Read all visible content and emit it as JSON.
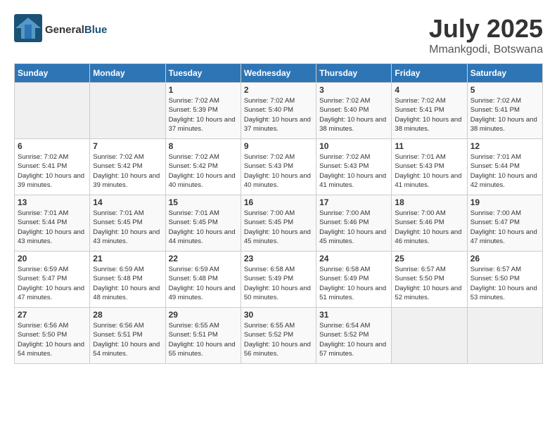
{
  "header": {
    "logo_general": "General",
    "logo_blue": "Blue",
    "month": "July 2025",
    "location": "Mmankgodi, Botswana"
  },
  "weekdays": [
    "Sunday",
    "Monday",
    "Tuesday",
    "Wednesday",
    "Thursday",
    "Friday",
    "Saturday"
  ],
  "weeks": [
    [
      {
        "day": "",
        "empty": true
      },
      {
        "day": "",
        "empty": true
      },
      {
        "day": "1",
        "sunrise": "7:02 AM",
        "sunset": "5:39 PM",
        "daylight": "10 hours and 37 minutes."
      },
      {
        "day": "2",
        "sunrise": "7:02 AM",
        "sunset": "5:40 PM",
        "daylight": "10 hours and 37 minutes."
      },
      {
        "day": "3",
        "sunrise": "7:02 AM",
        "sunset": "5:40 PM",
        "daylight": "10 hours and 38 minutes."
      },
      {
        "day": "4",
        "sunrise": "7:02 AM",
        "sunset": "5:41 PM",
        "daylight": "10 hours and 38 minutes."
      },
      {
        "day": "5",
        "sunrise": "7:02 AM",
        "sunset": "5:41 PM",
        "daylight": "10 hours and 38 minutes."
      }
    ],
    [
      {
        "day": "6",
        "sunrise": "7:02 AM",
        "sunset": "5:41 PM",
        "daylight": "10 hours and 39 minutes."
      },
      {
        "day": "7",
        "sunrise": "7:02 AM",
        "sunset": "5:42 PM",
        "daylight": "10 hours and 39 minutes."
      },
      {
        "day": "8",
        "sunrise": "7:02 AM",
        "sunset": "5:42 PM",
        "daylight": "10 hours and 40 minutes."
      },
      {
        "day": "9",
        "sunrise": "7:02 AM",
        "sunset": "5:43 PM",
        "daylight": "10 hours and 40 minutes."
      },
      {
        "day": "10",
        "sunrise": "7:02 AM",
        "sunset": "5:43 PM",
        "daylight": "10 hours and 41 minutes."
      },
      {
        "day": "11",
        "sunrise": "7:01 AM",
        "sunset": "5:43 PM",
        "daylight": "10 hours and 41 minutes."
      },
      {
        "day": "12",
        "sunrise": "7:01 AM",
        "sunset": "5:44 PM",
        "daylight": "10 hours and 42 minutes."
      }
    ],
    [
      {
        "day": "13",
        "sunrise": "7:01 AM",
        "sunset": "5:44 PM",
        "daylight": "10 hours and 43 minutes."
      },
      {
        "day": "14",
        "sunrise": "7:01 AM",
        "sunset": "5:45 PM",
        "daylight": "10 hours and 43 minutes."
      },
      {
        "day": "15",
        "sunrise": "7:01 AM",
        "sunset": "5:45 PM",
        "daylight": "10 hours and 44 minutes."
      },
      {
        "day": "16",
        "sunrise": "7:00 AM",
        "sunset": "5:45 PM",
        "daylight": "10 hours and 45 minutes."
      },
      {
        "day": "17",
        "sunrise": "7:00 AM",
        "sunset": "5:46 PM",
        "daylight": "10 hours and 45 minutes."
      },
      {
        "day": "18",
        "sunrise": "7:00 AM",
        "sunset": "5:46 PM",
        "daylight": "10 hours and 46 minutes."
      },
      {
        "day": "19",
        "sunrise": "7:00 AM",
        "sunset": "5:47 PM",
        "daylight": "10 hours and 47 minutes."
      }
    ],
    [
      {
        "day": "20",
        "sunrise": "6:59 AM",
        "sunset": "5:47 PM",
        "daylight": "10 hours and 47 minutes."
      },
      {
        "day": "21",
        "sunrise": "6:59 AM",
        "sunset": "5:48 PM",
        "daylight": "10 hours and 48 minutes."
      },
      {
        "day": "22",
        "sunrise": "6:59 AM",
        "sunset": "5:48 PM",
        "daylight": "10 hours and 49 minutes."
      },
      {
        "day": "23",
        "sunrise": "6:58 AM",
        "sunset": "5:49 PM",
        "daylight": "10 hours and 50 minutes."
      },
      {
        "day": "24",
        "sunrise": "6:58 AM",
        "sunset": "5:49 PM",
        "daylight": "10 hours and 51 minutes."
      },
      {
        "day": "25",
        "sunrise": "6:57 AM",
        "sunset": "5:50 PM",
        "daylight": "10 hours and 52 minutes."
      },
      {
        "day": "26",
        "sunrise": "6:57 AM",
        "sunset": "5:50 PM",
        "daylight": "10 hours and 53 minutes."
      }
    ],
    [
      {
        "day": "27",
        "sunrise": "6:56 AM",
        "sunset": "5:50 PM",
        "daylight": "10 hours and 54 minutes."
      },
      {
        "day": "28",
        "sunrise": "6:56 AM",
        "sunset": "5:51 PM",
        "daylight": "10 hours and 54 minutes."
      },
      {
        "day": "29",
        "sunrise": "6:55 AM",
        "sunset": "5:51 PM",
        "daylight": "10 hours and 55 minutes."
      },
      {
        "day": "30",
        "sunrise": "6:55 AM",
        "sunset": "5:52 PM",
        "daylight": "10 hours and 56 minutes."
      },
      {
        "day": "31",
        "sunrise": "6:54 AM",
        "sunset": "5:52 PM",
        "daylight": "10 hours and 57 minutes."
      },
      {
        "day": "",
        "empty": true
      },
      {
        "day": "",
        "empty": true
      }
    ]
  ]
}
